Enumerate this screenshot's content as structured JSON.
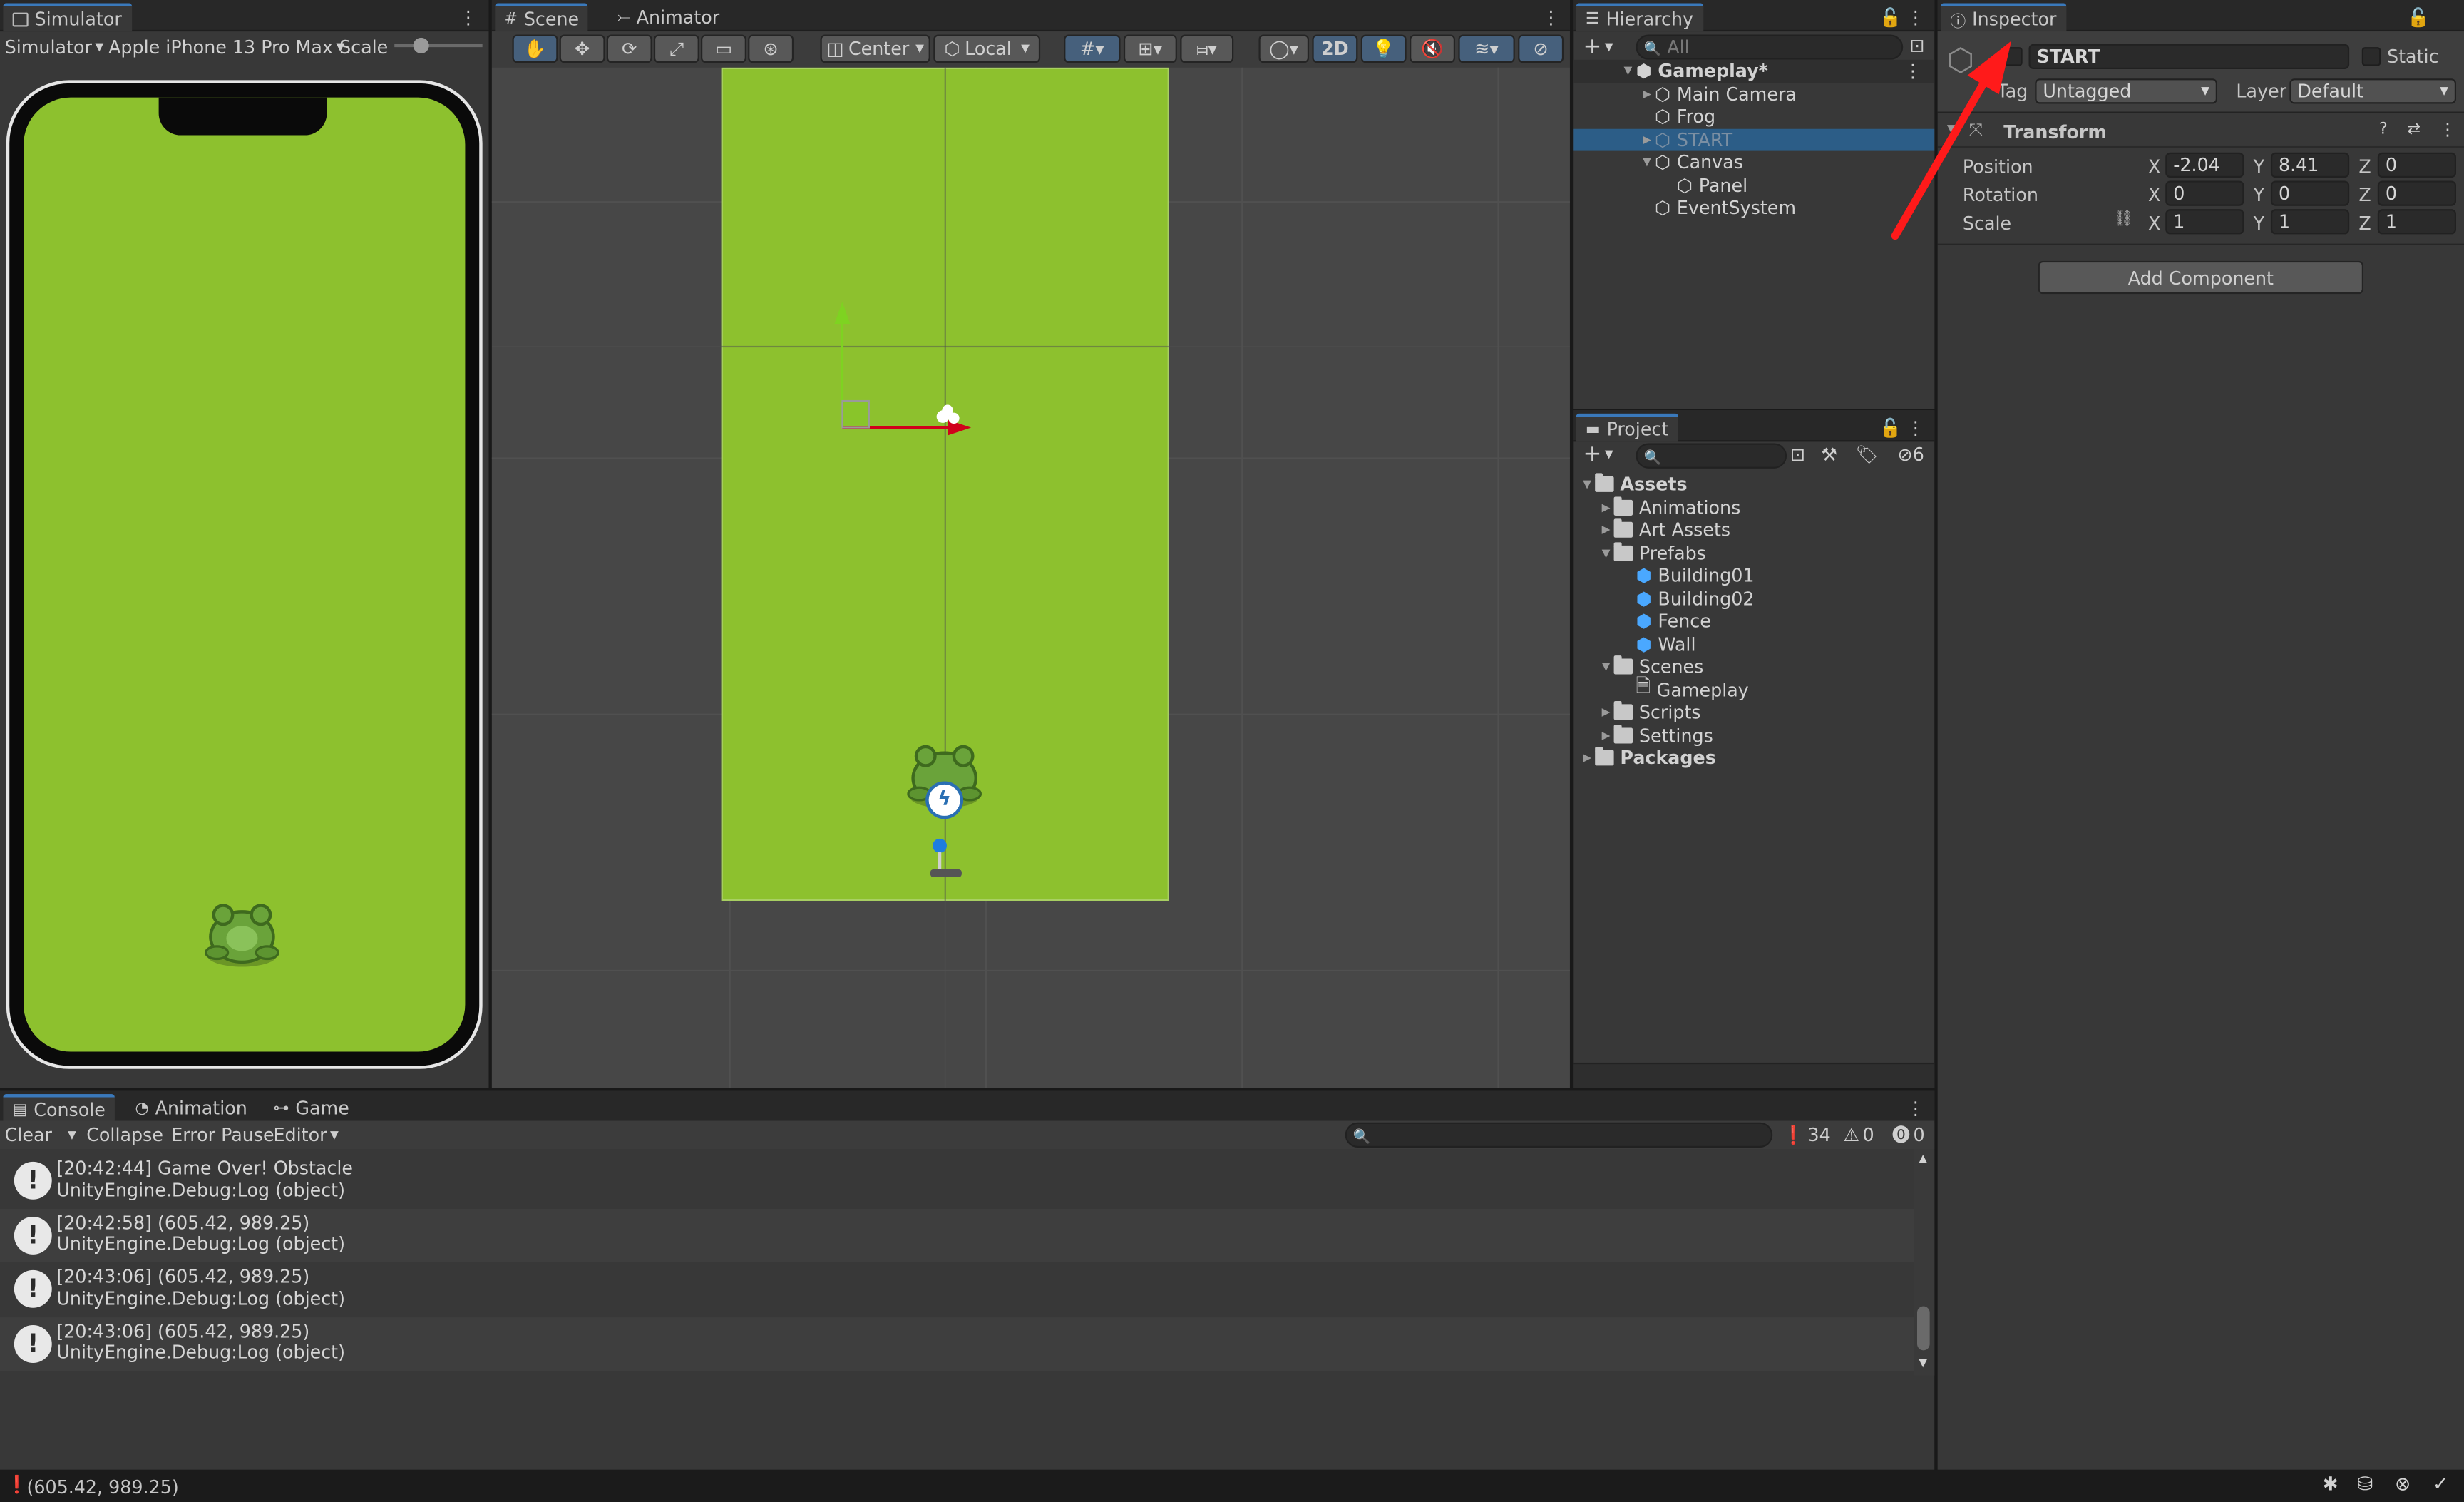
{
  "simulator": {
    "tab": "Simulator",
    "mode": "Simulator",
    "device": "Apple iPhone 13 Pro Max",
    "scale_label": "Scale"
  },
  "scene": {
    "tabs": [
      "Scene",
      "Animator"
    ],
    "pivot": "Center",
    "space": "Local",
    "mode_2d": "2D"
  },
  "hierarchy": {
    "tab": "Hierarchy",
    "search_placeholder": "All",
    "items": [
      {
        "label": "Gameplay*"
      },
      {
        "label": "Main Camera"
      },
      {
        "label": "Frog"
      },
      {
        "label": "START"
      },
      {
        "label": "Canvas"
      },
      {
        "label": "Panel"
      },
      {
        "label": "EventSystem"
      }
    ]
  },
  "inspector": {
    "tab": "Inspector",
    "object_name": "START",
    "static_label": "Static",
    "tag_label": "Tag",
    "tag_value": "Untagged",
    "layer_label": "Layer",
    "layer_value": "Default",
    "transform_title": "Transform",
    "position_label": "Position",
    "rotation_label": "Rotation",
    "scale_label": "Scale",
    "axis": {
      "x": "X",
      "y": "Y",
      "z": "Z"
    },
    "position": {
      "x": "-2.04",
      "y": "8.41",
      "z": "0"
    },
    "rotation": {
      "x": "0",
      "y": "0",
      "z": "0"
    },
    "scale": {
      "x": "1",
      "y": "1",
      "z": "1"
    },
    "add_component": "Add Component"
  },
  "project": {
    "tab": "Project",
    "hidden_count": "6",
    "items": [
      {
        "label": "Assets"
      },
      {
        "label": "Animations"
      },
      {
        "label": "Art Assets"
      },
      {
        "label": "Prefabs"
      },
      {
        "label": "Building01"
      },
      {
        "label": "Building02"
      },
      {
        "label": "Fence"
      },
      {
        "label": "Wall"
      },
      {
        "label": "Scenes"
      },
      {
        "label": "Gameplay"
      },
      {
        "label": "Scripts"
      },
      {
        "label": "Settings"
      },
      {
        "label": "Packages"
      }
    ]
  },
  "console": {
    "tabs": [
      "Console",
      "Animation",
      "Game"
    ],
    "clear": "Clear",
    "collapse": "Collapse",
    "error_pause": "Error Pause",
    "editor": "Editor",
    "counts": {
      "log": "34",
      "warn": "0",
      "error": "0"
    },
    "entries": [
      {
        "line1": "[20:42:44] Game Over! Obstacle",
        "line2": "UnityEngine.Debug:Log (object)"
      },
      {
        "line1": "[20:42:58] (605.42, 989.25)",
        "line2": "UnityEngine.Debug:Log (object)"
      },
      {
        "line1": "[20:43:06] (605.42, 989.25)",
        "line2": "UnityEngine.Debug:Log (object)"
      },
      {
        "line1": "[20:43:06] (605.42, 989.25)",
        "line2": "UnityEngine.Debug:Log (object)"
      }
    ]
  },
  "statusbar": {
    "message": "(605.42, 989.25)"
  },
  "colors": {
    "game_green": "#8dc12e",
    "selection": "#2c5d87",
    "annotation_arrow": "#ff1a1a"
  }
}
